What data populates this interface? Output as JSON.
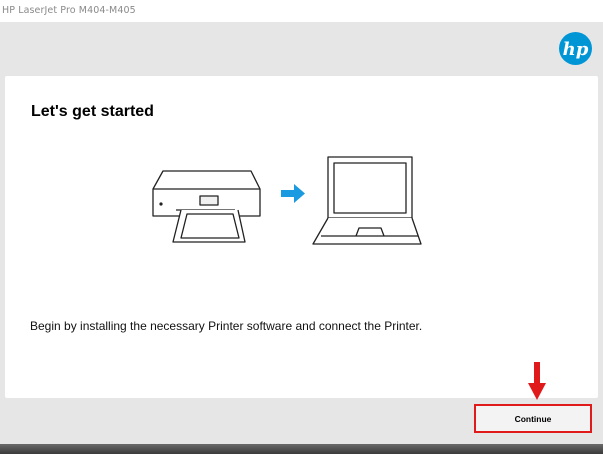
{
  "window": {
    "title": "HP LaserJet Pro M404-M405"
  },
  "brand": {
    "logo_icon": "hp-logo-icon",
    "logo_color": "#0096d6"
  },
  "main": {
    "heading": "Let's get started",
    "description": "Begin by installing the necessary Printer software and connect the Printer.",
    "illustration_icons": [
      "printer-icon",
      "right-arrow-icon",
      "laptop-icon"
    ],
    "accent_color": "#1a9ae0"
  },
  "footer": {
    "continue_label": "Continue",
    "highlight_color": "#e01a1a",
    "annotation_icon": "down-arrow-icon"
  }
}
